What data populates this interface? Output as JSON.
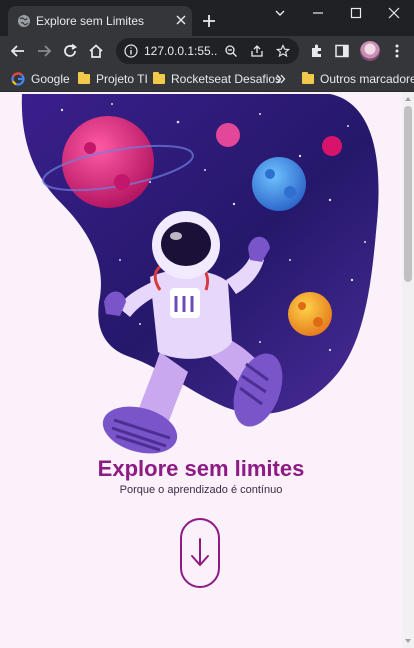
{
  "browser": {
    "tab_title": "Explore sem Limites",
    "url": "127.0.0.1:55..."
  },
  "bookmarks": [
    {
      "label": "Google",
      "icon": "google-icon"
    },
    {
      "label": "Projeto TI",
      "icon": "folder-icon"
    },
    {
      "label": "Rocketseat Desafios",
      "icon": "folder-icon"
    },
    {
      "label": "Outros marcadores",
      "icon": "folder-icon"
    }
  ],
  "hero": {
    "title": "Explore sem limites",
    "subtitle": "Porque o aprendizado é contínuo"
  },
  "colors": {
    "accent": "#8e1a84",
    "page_background": "#faf1fb",
    "space_dark": "#1f1760",
    "space_light": "#4a2c9a"
  }
}
